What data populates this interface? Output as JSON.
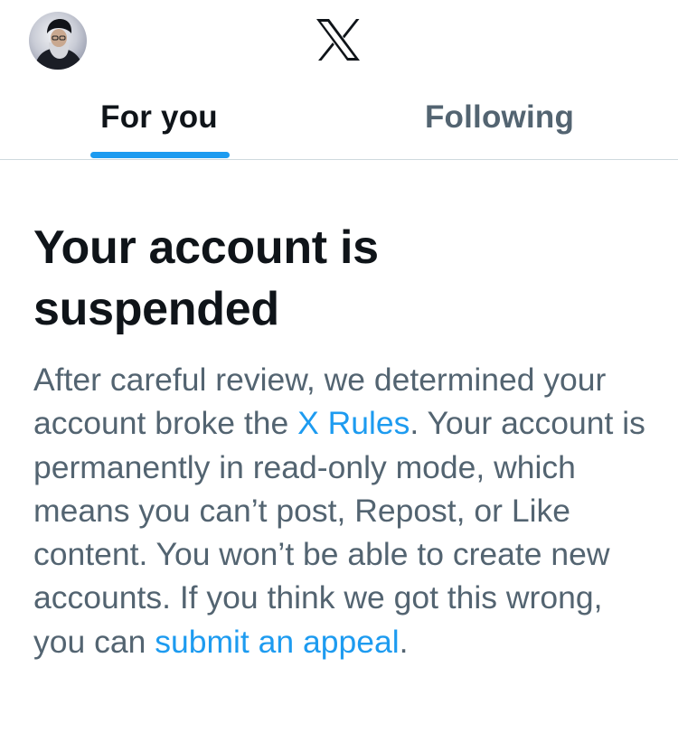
{
  "header": {
    "avatar_icon": "user-avatar",
    "logo_icon": "x-logo-icon"
  },
  "tabs": [
    {
      "label": "For you",
      "selected": true
    },
    {
      "label": "Following",
      "selected": false
    }
  ],
  "notice": {
    "title_line1": "Your account is",
    "title_line2": "suspended",
    "text_1": "After careful review, we determined your account broke the ",
    "link_rules": "X Rules",
    "text_2": ". Your account is permanently in read-only mode, which means you can’t post, Repost, or Like content. You won’t be able to create new accounts. If you think we got this wrong, you can ",
    "link_appeal": "submit an appeal",
    "text_3": "."
  },
  "colors": {
    "accent": "#1d9bf0",
    "text_primary": "#0f1419",
    "text_secondary": "#536471",
    "divider": "#cfd9de"
  }
}
